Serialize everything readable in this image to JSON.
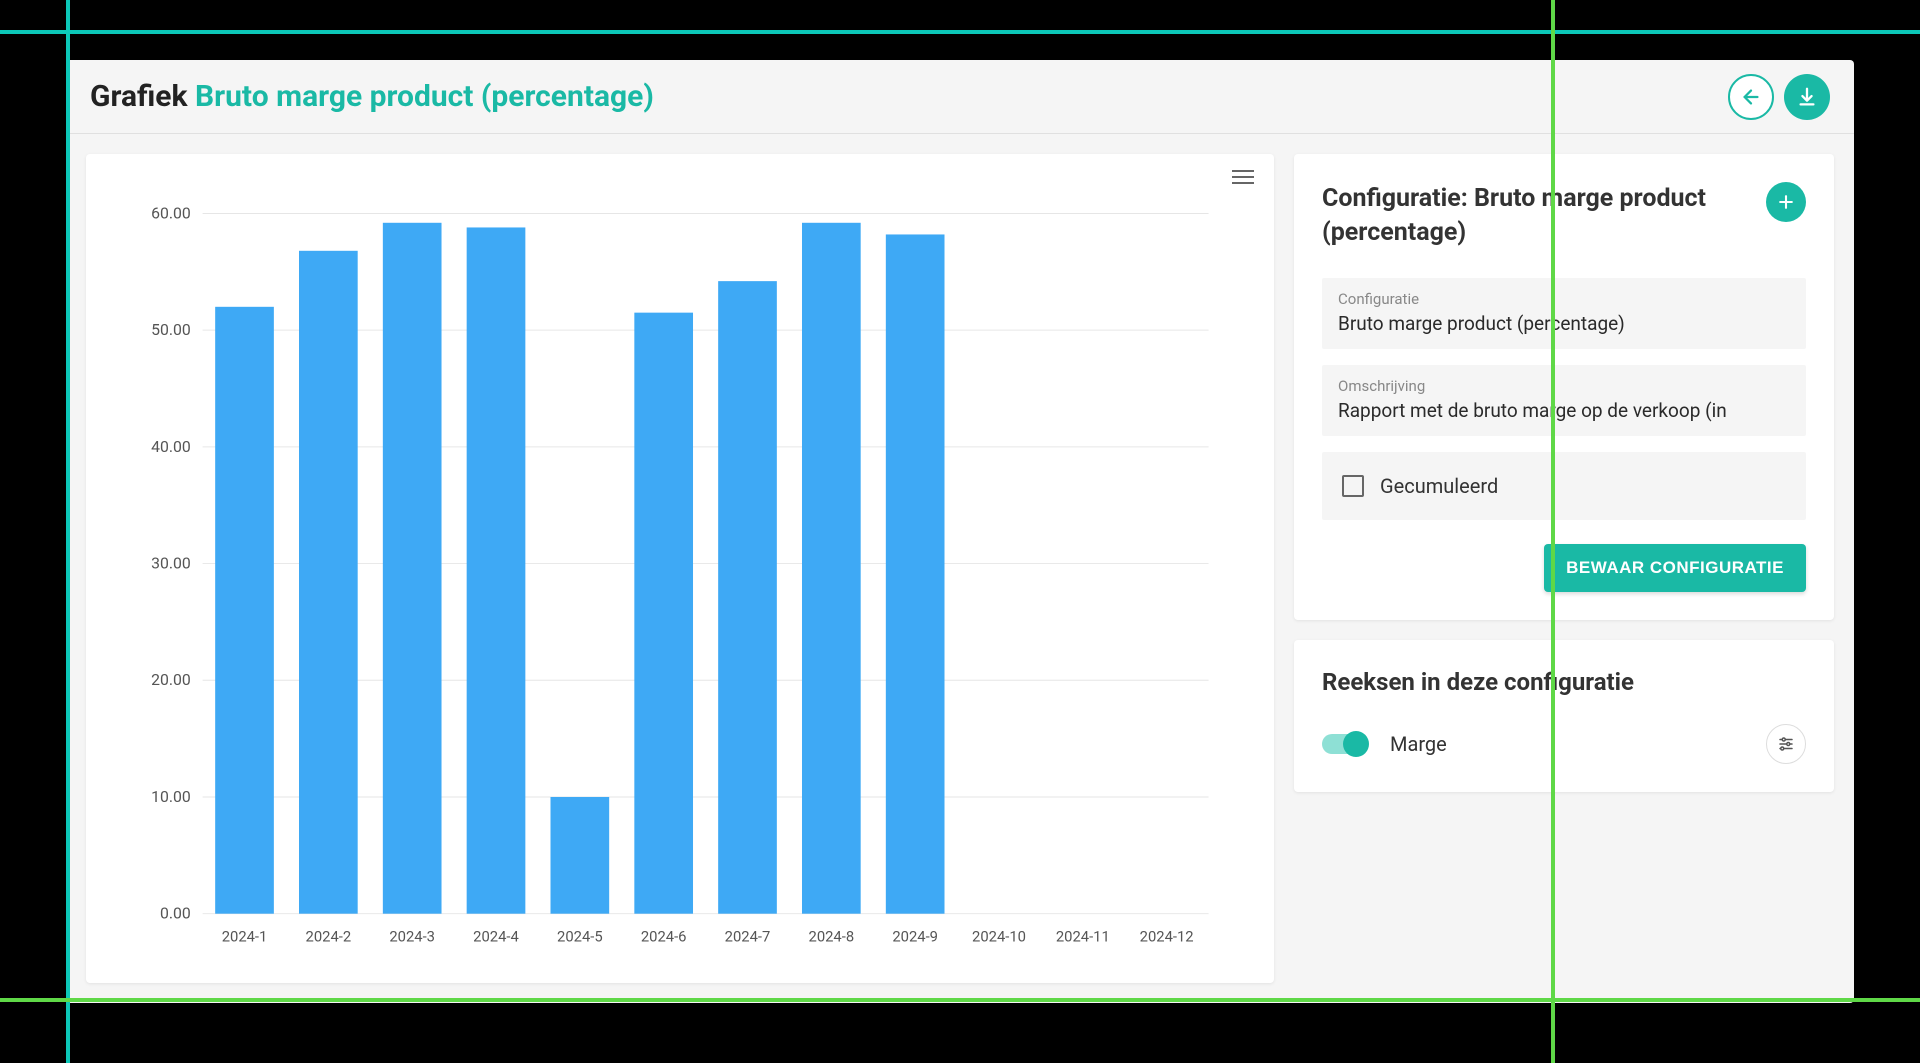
{
  "header": {
    "prefix": "Grafiek",
    "title": "Bruto marge product (percentage)"
  },
  "config": {
    "heading": "Configuratie: Bruto marge product (percentage)",
    "name_label": "Configuratie",
    "name_value": "Bruto marge product (percentage)",
    "desc_label": "Omschrijving",
    "desc_value": "Rapport met de bruto marge op de verkoop (in",
    "cumulative_label": "Gecumuleerd",
    "save_label": "BEWAAR CONFIGURATIE"
  },
  "series_section": {
    "heading": "Reeksen in deze configuratie",
    "items": [
      {
        "name": "Marge",
        "enabled": true
      }
    ]
  },
  "chart_data": {
    "type": "bar",
    "categories": [
      "2024-1",
      "2024-2",
      "2024-3",
      "2024-4",
      "2024-5",
      "2024-6",
      "2024-7",
      "2024-8",
      "2024-9",
      "2024-10",
      "2024-11",
      "2024-12"
    ],
    "values": [
      52.0,
      56.8,
      59.2,
      58.8,
      10.0,
      51.5,
      54.2,
      59.2,
      58.2,
      0,
      0,
      0
    ],
    "ylim": [
      0,
      60
    ],
    "yticks": [
      0,
      10,
      20,
      30,
      40,
      50,
      60
    ],
    "series_name": "Marge",
    "bar_color": "#3ea9f5"
  }
}
